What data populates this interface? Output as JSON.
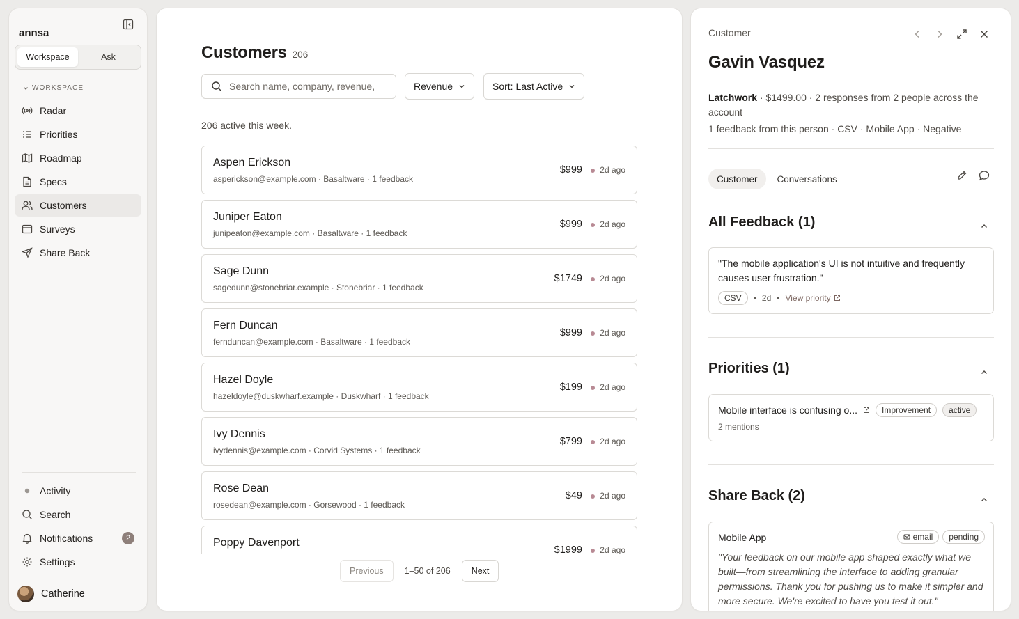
{
  "sidebar": {
    "brand": "annsa",
    "segments": [
      "Workspace",
      "Ask"
    ],
    "section_label": "WORKSPACE",
    "items": [
      {
        "label": "Radar",
        "icon": "radar-icon"
      },
      {
        "label": "Priorities",
        "icon": "list-icon"
      },
      {
        "label": "Roadmap",
        "icon": "map-icon"
      },
      {
        "label": "Specs",
        "icon": "document-icon"
      },
      {
        "label": "Customers",
        "icon": "users-icon"
      },
      {
        "label": "Surveys",
        "icon": "calendar-icon"
      },
      {
        "label": "Share Back",
        "icon": "send-icon"
      }
    ],
    "bottom": [
      {
        "label": "Activity",
        "icon": "dot-icon"
      },
      {
        "label": "Search",
        "icon": "search-icon"
      },
      {
        "label": "Notifications",
        "icon": "bell-icon",
        "badge": "2"
      },
      {
        "label": "Settings",
        "icon": "gear-icon"
      }
    ],
    "user": "Catherine"
  },
  "main": {
    "title": "Customers",
    "count": "206",
    "search_placeholder": "Search name, company, revenue,",
    "filter_label": "Revenue",
    "sort_label": "Sort: Last Active",
    "active_text": "206 active this week.",
    "customers": [
      {
        "name": "Aspen Erickson",
        "meta": "asperickson@example.com · Basaltware · 1 feedback",
        "amount": "$999",
        "ago": "2d ago"
      },
      {
        "name": "Juniper Eaton",
        "meta": "junipeaton@example.com · Basaltware · 1 feedback",
        "amount": "$999",
        "ago": "2d ago"
      },
      {
        "name": "Sage Dunn",
        "meta": "sagedunn@stonebriar.example · Stonebriar · 1 feedback",
        "amount": "$1749",
        "ago": "2d ago"
      },
      {
        "name": "Fern Duncan",
        "meta": "fernduncan@example.com · Basaltware · 1 feedback",
        "amount": "$999",
        "ago": "2d ago"
      },
      {
        "name": "Hazel Doyle",
        "meta": "hazeldoyle@duskwharf.example · Duskwharf · 1 feedback",
        "amount": "$199",
        "ago": "2d ago"
      },
      {
        "name": "Ivy Dennis",
        "meta": "ivydennis@example.com · Corvid Systems · 1 feedback",
        "amount": "$799",
        "ago": "2d ago"
      },
      {
        "name": "Rose Dean",
        "meta": "rosedean@example.com · Gorsewood · 1 feedback",
        "amount": "$49",
        "ago": "2d ago"
      },
      {
        "name": "Poppy Davenport",
        "meta": "",
        "amount": "$1999",
        "ago": "2d ago"
      }
    ],
    "pager": {
      "previous": "Previous",
      "info": "1–50 of 206",
      "next": "Next"
    }
  },
  "detail": {
    "label": "Customer",
    "name": "Gavin Vasquez",
    "company": "Latchwork",
    "summary_rest": " · $1499.00 · 2 responses from 2 people across the account",
    "summary2": "1 feedback from this person · CSV · Mobile App · Negative",
    "tabs": [
      "Customer",
      "Conversations"
    ],
    "feedback_title": "All Feedback (1)",
    "feedback_quote": "\"The mobile application's UI is not intuitive and frequently causes user frustration.\"",
    "feedback_source": "CSV",
    "feedback_age": "2d",
    "feedback_link": "View priority",
    "priorities_title": "Priorities (1)",
    "priority_name": "Mobile interface is confusing o...",
    "priority_type": "Improvement",
    "priority_status": "active",
    "priority_mentions": "2 mentions",
    "shareback_title": "Share Back (2)",
    "shareback_name": "Mobile App",
    "shareback_channel": "email",
    "shareback_status": "pending",
    "shareback_quote": "\"Your feedback on our mobile app shaped exactly what we built—from streamlining the interface to adding granular permissions. Thank you for pushing us to make it simpler and more secure. We're excited to have you test it out.\""
  },
  "colors": {
    "accent_dot": "#b88a94",
    "badge": "#8e7f7a",
    "background": "#ecebe9"
  }
}
